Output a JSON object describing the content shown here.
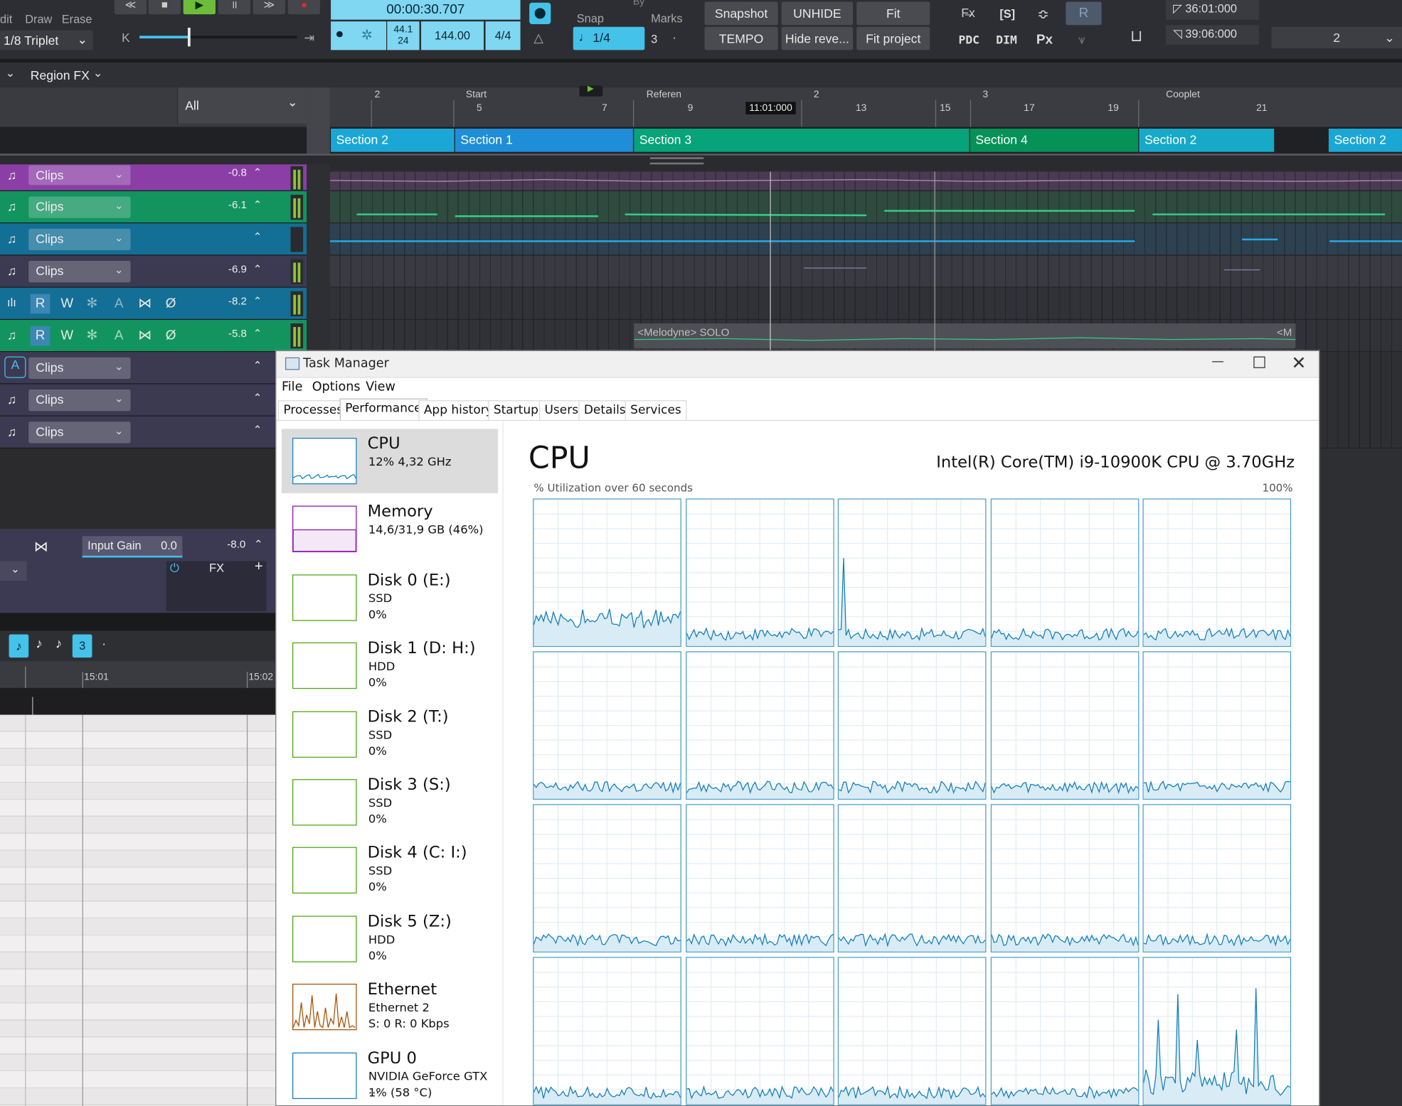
{
  "daw": {
    "toolbar": {
      "tools": [
        "dit",
        "Draw",
        "Erase"
      ],
      "grid_select": "1/8 Triplet",
      "time_display": "00:00:30.707",
      "sample_rate": "44.1",
      "bit_depth": "24",
      "tempo": "144.00",
      "meter": "4/4",
      "snap_label": "Snap",
      "by_label": "By",
      "marks_label": "Marks",
      "snap_value": "1/4",
      "snap_count": "3",
      "snap_dot": "·",
      "buttons": {
        "snapshot": "Snapshot",
        "unhide": "UNHIDE",
        "fit": "Fit",
        "tempo": "TEMPO",
        "hide_reveal": "Hide reve...",
        "fit_project": "Fit project"
      },
      "indicators": {
        "s": "[S]",
        "r": "R",
        "pdc": "PDC",
        "dim": "DIM",
        "px": "Px"
      },
      "loop_start": "36:01:000",
      "loop_end": "39:06:000",
      "right_select": "2"
    },
    "region_fx_label": "Region FX",
    "filter_value": "All",
    "ruler": {
      "playhead_time": "11:01:000",
      "markers": [
        {
          "label": "2",
          "num": ""
        },
        {
          "label": "Start",
          "num": "5"
        },
        {
          "label": "",
          "num": "7"
        },
        {
          "label": "Referen",
          "num": "9"
        },
        {
          "label": "2",
          "num": "13"
        },
        {
          "label": "",
          "num": "15"
        },
        {
          "label": "3",
          "num": "17"
        },
        {
          "label": "",
          "num": "19"
        },
        {
          "label": "Cooplet",
          "num": "21"
        }
      ]
    },
    "sections": [
      "Section 2",
      "Section 1",
      "Section 3",
      "Section 4",
      "Section 2",
      "Section 2"
    ],
    "tracks": [
      {
        "clips": "Clips",
        "vol": "-0.8",
        "color": "#8b3fa6"
      },
      {
        "clips": "Clips",
        "vol": "-6.1",
        "color": "#13945e"
      },
      {
        "clips": "Clips",
        "vol": "",
        "color": "#136f95"
      },
      {
        "clips": "Clips",
        "vol": "-6.9",
        "color": "#3c3a52"
      },
      {
        "vol": "-8.2",
        "color": "#136f95",
        "rw": [
          "R",
          "W",
          "✻",
          "A",
          "⋈",
          "Ø"
        ]
      },
      {
        "vol": "-5.8",
        "color": "#13945e",
        "rw": [
          "R",
          "W",
          "✻",
          "A",
          "⋈",
          "Ø"
        ]
      },
      {
        "clips": "Clips",
        "vol": "",
        "color": "#3c3a52"
      },
      {
        "clips": "Clips",
        "vol": "",
        "color": "#3c3a52"
      },
      {
        "clips": "Clips",
        "vol": "",
        "color": "#3c3a52"
      }
    ],
    "melodyne_clip": "<Melodyne> SOLO",
    "melodyne_clip_tail": "<M",
    "input_gain_label": "Input Gain",
    "input_gain_value": "0.0",
    "lower_vol": "-8.0",
    "fx_label": "FX",
    "lower_ruler": [
      "15:01",
      "15:02"
    ],
    "lower_snap_count": "3",
    "lower_snap_dot": "·"
  },
  "task_manager": {
    "title": "Task Manager",
    "menu": [
      "File",
      "Options",
      "View"
    ],
    "tabs": [
      "Processes",
      "Performance",
      "App history",
      "Startup",
      "Users",
      "Details",
      "Services"
    ],
    "active_tab": "Performance",
    "resources": [
      {
        "name": "CPU",
        "l2": "12%  4,32 GHz",
        "l3": "",
        "color": "#117dbb"
      },
      {
        "name": "Memory",
        "l2": "14,6/31,9 GB (46%)",
        "l3": "",
        "color": "#8b12ae"
      },
      {
        "name": "Disk 0 (E:)",
        "l2": "SSD",
        "l3": "0%",
        "color": "#4da60c"
      },
      {
        "name": "Disk 1 (D: H:)",
        "l2": "HDD",
        "l3": "0%",
        "color": "#4da60c"
      },
      {
        "name": "Disk 2 (T:)",
        "l2": "SSD",
        "l3": "0%",
        "color": "#4da60c"
      },
      {
        "name": "Disk 3 (S:)",
        "l2": "SSD",
        "l3": "0%",
        "color": "#4da60c"
      },
      {
        "name": "Disk 4 (C: I:)",
        "l2": "SSD",
        "l3": "0%",
        "color": "#4da60c"
      },
      {
        "name": "Disk 5 (Z:)",
        "l2": "HDD",
        "l3": "0%",
        "color": "#4da60c"
      },
      {
        "name": "Ethernet",
        "l2": "Ethernet 2",
        "l3": "S: 0  R: 0 Kbps",
        "color": "#a74f01"
      },
      {
        "name": "GPU 0",
        "l2": "NVIDIA GeForce GTX ...",
        "l3": "1% (58 °C)",
        "color": "#117dbb"
      }
    ],
    "cpu_title": "CPU",
    "cpu_model": "Intel(R) Core(TM) i9-10900K CPU @ 3.70GHz",
    "util_label": "% Utilization over 60 seconds",
    "util_max": "100%",
    "core_count": 20,
    "core_color": "#117dbb"
  }
}
